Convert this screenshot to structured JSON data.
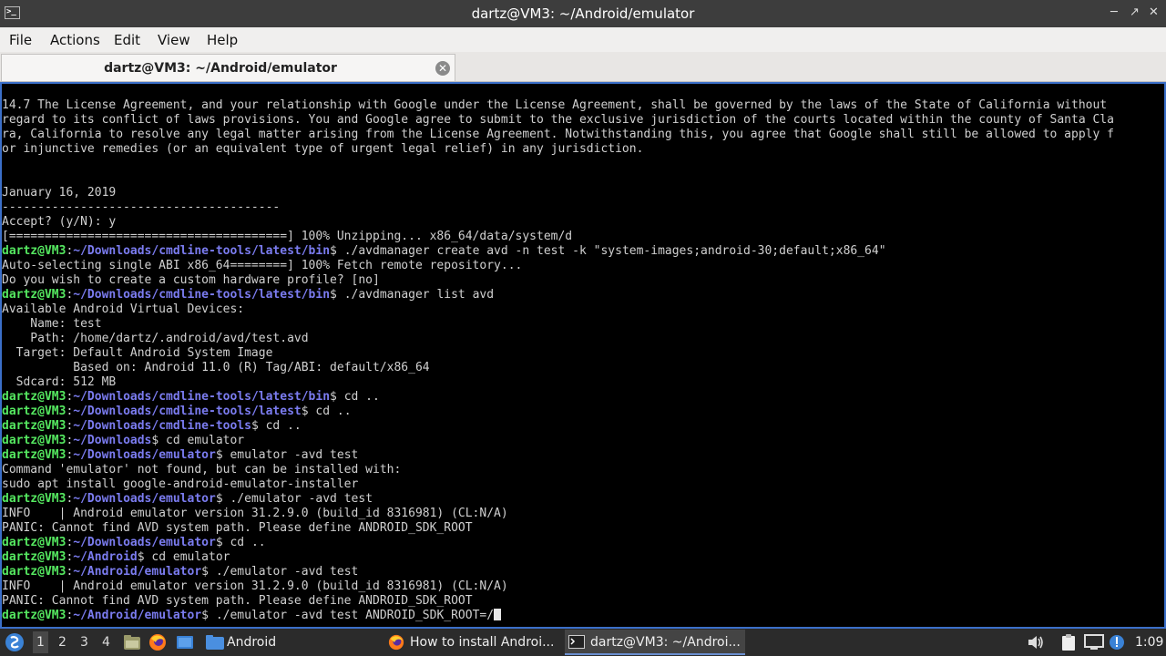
{
  "window": {
    "title": "dartz@VM3: ~/Android/emulator",
    "icon": "terminal-icon"
  },
  "menu": {
    "items": [
      "File",
      "Actions",
      "Edit",
      "View",
      "Help"
    ]
  },
  "tabs": [
    {
      "label": "dartz@VM3: ~/Android/emulator",
      "close_icon": "close-circle-icon"
    }
  ],
  "terminal": {
    "colors": {
      "background": "#000000",
      "text": "#d0d0d0",
      "prompt_user": "#55e860",
      "prompt_path": "#7b7cf0"
    },
    "lines": [
      {
        "text": "14.7 The License Agreement, and your relationship with Google under the License Agreement, shall be governed by the laws of the State of California without"
      },
      {
        "text": "regard to its conflict of laws provisions. You and Google agree to submit to the exclusive jurisdiction of the courts located within the county of Santa Cla"
      },
      {
        "text": "ra, California to resolve any legal matter arising from the License Agreement. Notwithstanding this, you agree that Google shall still be allowed to apply f"
      },
      {
        "text": "or injunctive remedies (or an equivalent type of urgent legal relief) in any jurisdiction."
      },
      {
        "text": ""
      },
      {
        "text": ""
      },
      {
        "text": "January 16, 2019"
      },
      {
        "text": "---------------------------------------"
      },
      {
        "text": "Accept? (y/N): y"
      },
      {
        "text": "[=======================================] 100% Unzipping... x86_64/data/system/d"
      },
      {
        "user": "dartz@VM3",
        "path": "~/Downloads/cmdline-tools/latest/bin",
        "cmd": " ./avdmanager create avd -n test -k \"system-images;android-30;default;x86_64\""
      },
      {
        "text": "Auto-selecting single ABI x86_64========] 100% Fetch remote repository..."
      },
      {
        "text": "Do you wish to create a custom hardware profile? [no]"
      },
      {
        "user": "dartz@VM3",
        "path": "~/Downloads/cmdline-tools/latest/bin",
        "cmd": " ./avdmanager list avd"
      },
      {
        "text": "Available Android Virtual Devices:"
      },
      {
        "text": "    Name: test"
      },
      {
        "text": "    Path: /home/dartz/.android/avd/test.avd"
      },
      {
        "text": "  Target: Default Android System Image"
      },
      {
        "text": "          Based on: Android 11.0 (R) Tag/ABI: default/x86_64"
      },
      {
        "text": "  Sdcard: 512 MB"
      },
      {
        "user": "dartz@VM3",
        "path": "~/Downloads/cmdline-tools/latest/bin",
        "cmd": " cd .."
      },
      {
        "user": "dartz@VM3",
        "path": "~/Downloads/cmdline-tools/latest",
        "cmd": " cd .."
      },
      {
        "user": "dartz@VM3",
        "path": "~/Downloads/cmdline-tools",
        "cmd": " cd .."
      },
      {
        "user": "dartz@VM3",
        "path": "~/Downloads",
        "cmd": " cd emulator"
      },
      {
        "user": "dartz@VM3",
        "path": "~/Downloads/emulator",
        "cmd": " emulator -avd test"
      },
      {
        "text": "Command 'emulator' not found, but can be installed with:"
      },
      {
        "text": "sudo apt install google-android-emulator-installer"
      },
      {
        "user": "dartz@VM3",
        "path": "~/Downloads/emulator",
        "cmd": " ./emulator -avd test"
      },
      {
        "text": "INFO    | Android emulator version 31.2.9.0 (build_id 8316981) (CL:N/A)"
      },
      {
        "text": "PANIC: Cannot find AVD system path. Please define ANDROID_SDK_ROOT"
      },
      {
        "user": "dartz@VM3",
        "path": "~/Downloads/emulator",
        "cmd": " cd .."
      },
      {
        "user": "dartz@VM3",
        "path": "~/Android",
        "cmd": " cd emulator"
      },
      {
        "user": "dartz@VM3",
        "path": "~/Android/emulator",
        "cmd": " ./emulator -avd test"
      },
      {
        "text": "INFO    | Android emulator version 31.2.9.0 (build_id 8316981) (CL:N/A)"
      },
      {
        "text": "PANIC: Cannot find AVD system path. Please define ANDROID_SDK_ROOT"
      },
      {
        "user": "dartz@VM3",
        "path": "~/Android/emulator",
        "cmd": " ./emulator -avd test ANDROID_SDK_ROOT=/",
        "cursor": true
      }
    ]
  },
  "taskbar": {
    "start_icon": "start-menu-icon",
    "workspaces": [
      "1",
      "2",
      "3",
      "4"
    ],
    "quick_launch": [
      "file-manager-icon",
      "firefox-icon",
      "show-desktop-icon"
    ],
    "tasks": [
      {
        "label": "Android",
        "icon": "folder-icon"
      },
      {
        "label": "How to install Androi...",
        "icon": "firefox-icon"
      },
      {
        "label": "dartz@VM3: ~/Androi...",
        "icon": "terminal-icon"
      }
    ],
    "tray": [
      "volume-icon",
      "clipboard-icon",
      "display-icon",
      "update-notification-icon"
    ],
    "clock": "1:09"
  }
}
